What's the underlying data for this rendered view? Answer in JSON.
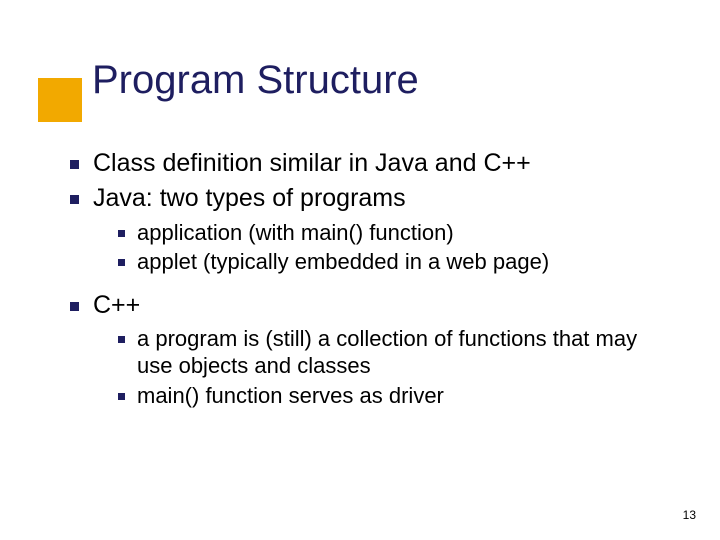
{
  "title": "Program Structure",
  "points": [
    {
      "text": "Class definition similar in Java and C++"
    },
    {
      "text": "Java:  two types of programs",
      "sub": [
        "application (with main() function)",
        "applet (typically embedded in a web page)"
      ]
    },
    {
      "text": "C++",
      "sub": [
        "a program is (still) a collection of functions that may use objects and classes",
        "main() function serves as driver"
      ]
    }
  ],
  "page_number": "13",
  "colors": {
    "accent": "#f2a900",
    "heading": "#1e1e60",
    "bullet": "#1e1e60"
  }
}
